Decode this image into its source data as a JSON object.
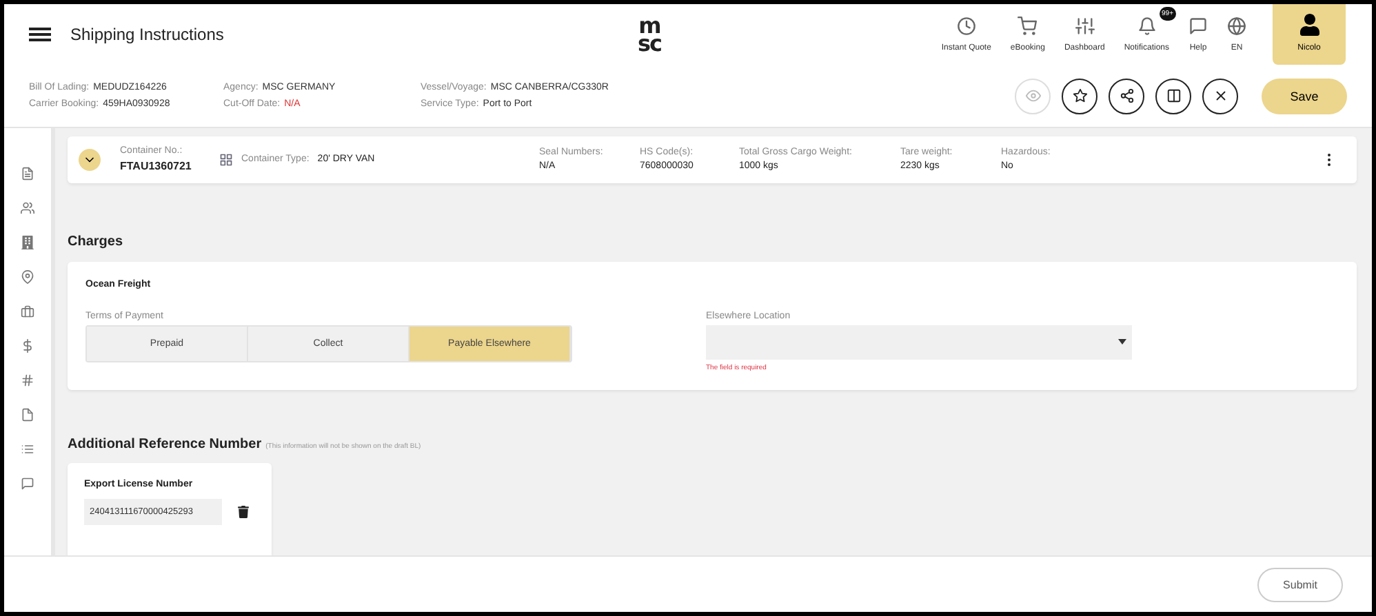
{
  "header": {
    "title": "Shipping Instructions",
    "logo": [
      "m",
      "sc"
    ],
    "nav": [
      {
        "label": "Instant Quote"
      },
      {
        "label": "eBooking"
      },
      {
        "label": "Dashboard"
      },
      {
        "label": "Notifications",
        "badge": "99+"
      },
      {
        "label": "Help"
      },
      {
        "label": "EN"
      }
    ],
    "user": {
      "name": "Nicolo"
    }
  },
  "info": [
    [
      {
        "label": "Bill Of Lading:",
        "value": "MEDUDZ164226",
        "error": false
      },
      {
        "label": "Carrier Booking:",
        "value": "459HA0930928",
        "error": false
      }
    ],
    [
      {
        "label": "Agency:",
        "value": "MSC GERMANY",
        "error": false
      },
      {
        "label": "Cut-Off Date:",
        "value": "N/A",
        "error": true
      }
    ],
    [
      {
        "label": "Vessel/Voyage:",
        "value": "MSC CANBERRA/CG330R",
        "error": false
      },
      {
        "label": "Service Type:",
        "value": "Port to Port",
        "error": false
      }
    ]
  ],
  "actions": [
    {
      "disabled": true
    },
    {
      "disabled": false
    },
    {
      "disabled": false
    },
    {
      "disabled": false
    },
    {
      "disabled": false
    }
  ],
  "save_button": "Save",
  "container": {
    "expanded": false,
    "number_label": "Container No.:",
    "number": "FTAU1360721",
    "type_label": "Container Type:",
    "type": "20' DRY VAN",
    "fields": [
      {
        "label": "Seal Numbers:",
        "value": "N/A"
      },
      {
        "label": "HS Code(s):",
        "value": "7608000030"
      },
      {
        "label": "Total Gross Cargo Weight:",
        "value": "1000 kgs"
      },
      {
        "label": "Tare weight:",
        "value": "2230 kgs"
      },
      {
        "label": "Hazardous:",
        "value": "No"
      }
    ]
  },
  "charges": {
    "title": "Charges",
    "card_title": "Ocean Freight",
    "terms_label": "Terms of Payment",
    "terms": [
      {
        "label": "Prepaid",
        "selected": false
      },
      {
        "label": "Collect",
        "selected": false
      },
      {
        "label": "Payable Elsewhere",
        "selected": true
      }
    ],
    "location_label": "Elsewhere Location",
    "location_error": "The field is required"
  },
  "reference": {
    "title": "Additional Reference Number",
    "note": "(This information will not be shown on the draft BL)",
    "card_title": "Export License Number",
    "value": "240413111670000425293"
  },
  "submit_button": "Submit"
}
